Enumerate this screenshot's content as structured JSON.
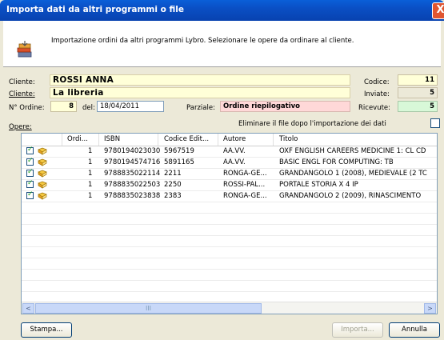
{
  "window": {
    "title": "Importa dati da altri programmi o file",
    "close_glyph": "X"
  },
  "header": {
    "text": "Importazione ordini da altri programmi Lybro. Selezionare le opere da ordinare al cliente.",
    "icon": "import-books-icon"
  },
  "form": {
    "cliente1_label": "Cliente:",
    "cliente1_value": "ROSSI ANNA",
    "cliente2_label": "Cliente:",
    "cliente2_value": "La libreria",
    "ordine_label": "N° Ordine:",
    "ordine_value": "8",
    "del_label": "del:",
    "del_value": "18/04/2011",
    "parziale_label": "Parziale:",
    "parziale_value": "Ordine riepilogativo",
    "codice_label": "Codice:",
    "codice_value": "11",
    "inviate_label": "Inviate:",
    "inviate_value": "5",
    "ricevute_label": "Ricevute:",
    "ricevute_value": "5",
    "opere_label": "Opere:",
    "eliminare_label": "Eliminare il file dopo l'importazione dei dati",
    "eliminare_checked": false
  },
  "colors": {
    "yellow_field": "#ffffd8",
    "pink_field": "#ffd8d8",
    "green_field": "#d8f8d8",
    "title_blue": "#0a4fc4"
  },
  "table": {
    "headers": {
      "ordi": "Ordi...",
      "isbn": "ISBN",
      "codice": "Codice Edit...",
      "autore": "Autore",
      "titolo": "Titolo"
    },
    "rows": [
      {
        "checked": true,
        "qty": "1",
        "isbn": "9780194023030",
        "codice": "5967519",
        "autore": "AA.VV.",
        "titolo": "OXF ENGLISH CAREERS MEDICINE 1: CL CD"
      },
      {
        "checked": true,
        "qty": "1",
        "isbn": "9780194574716",
        "codice": "5891165",
        "autore": "AA.VV.",
        "titolo": "BASIC ENGL FOR COMPUTING: TB"
      },
      {
        "checked": true,
        "qty": "1",
        "isbn": "9788835022114",
        "codice": "2211",
        "autore": "RONGA-GE...",
        "titolo": "GRANDANGOLO 1 (2008), MEDIEVALE (2 TC"
      },
      {
        "checked": true,
        "qty": "1",
        "isbn": "9788835022503",
        "codice": "2250",
        "autore": "ROSSI-PAL...",
        "titolo": "PORTALE STORIA X 4 IP"
      },
      {
        "checked": true,
        "qty": "1",
        "isbn": "9788835023838",
        "codice": "2383",
        "autore": "RONGA-GE...",
        "titolo": "GRANDANGOLO 2 (2009), RINASCIMENTO"
      }
    ]
  },
  "buttons": {
    "stampa": "Stampa...",
    "importa": "Importa...",
    "annulla": "Annulla"
  },
  "scroll": {
    "left_glyph": "<",
    "right_glyph": ">",
    "thumb_glyph": "III"
  }
}
